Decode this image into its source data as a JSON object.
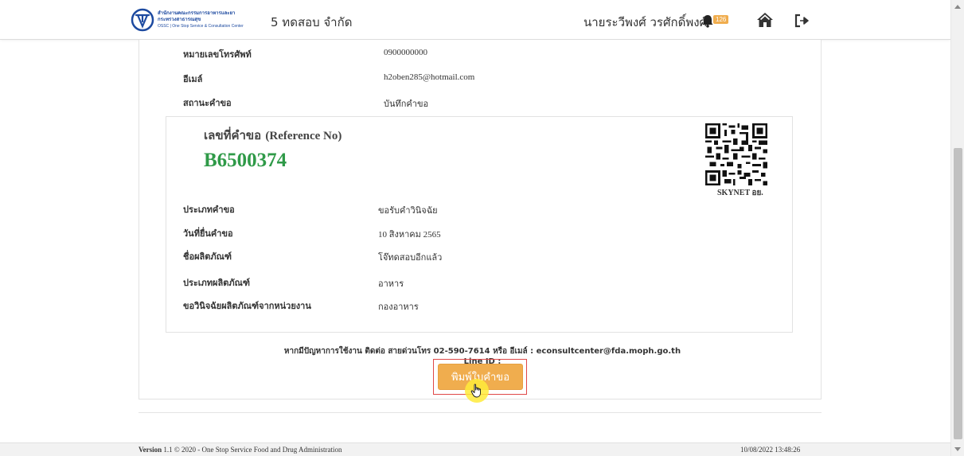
{
  "header": {
    "logo": {
      "line1": "สำนักงานคณะกรรมการอาหารและยา",
      "line2": "กระทรวงสาธารณสุข",
      "line3": "OSSC | One Stop Service & Consultation Center"
    },
    "company": "5 ทดสอบ จำกัด",
    "username": "นายระวีพงศ์ วรศักดิ์พงศ์",
    "notification_count": "126",
    "icons": {
      "notification": "bell-icon",
      "home": "home-icon",
      "logout": "logout-icon"
    }
  },
  "contact": [
    {
      "label": "หมายเลขโทรศัพท์",
      "value": "0900000000"
    },
    {
      "label": "อีเมล์",
      "value": "h2oben285@hotmail.com"
    },
    {
      "label": "สถานะคำขอ",
      "value": "บันทึกคำขอ"
    }
  ],
  "reference": {
    "label_th": "เลขที่คำขอ",
    "label_en": "(Reference No)",
    "number": "B6500374",
    "qr_caption": "SKYNET อย."
  },
  "details": [
    {
      "label": "ประเภทคำขอ",
      "value": "ขอรับคำวินิจฉัย"
    },
    {
      "label": "วันที่ยื่นคำขอ",
      "value": "10 สิงหาคม 2565"
    },
    {
      "label": "ชื่อผลิตภัณฑ์",
      "value": "โจ๊ทดสอบอีกแล้ว"
    },
    {
      "label": "ประเภทผลิตภัณฑ์",
      "value": "อาหาร"
    },
    {
      "label": "ขอวินิจฉัยผลิตภัณฑ์จากหน่วยงาน",
      "value": "กองอาหาร"
    }
  ],
  "help_text": "หากมีปัญหาการใช้งาน ติดต่อ สายด่วนโทร 02-590-7614 หรือ อีเมล์ : econsultcenter@fda.moph.go.th Line ID :",
  "print_button": "พิมพ์ใบคำขอ",
  "footer": {
    "version_label": "Version",
    "version_text": "1.1 © 2020 - One Stop Service Food and Drug Administration",
    "timestamp": "10/08/2022 13:48:26"
  },
  "colors": {
    "reference_number": "#2f9a48",
    "button": "#f0ad4e",
    "highlight_border": "#e04848",
    "badge": "#f0ad4e"
  }
}
